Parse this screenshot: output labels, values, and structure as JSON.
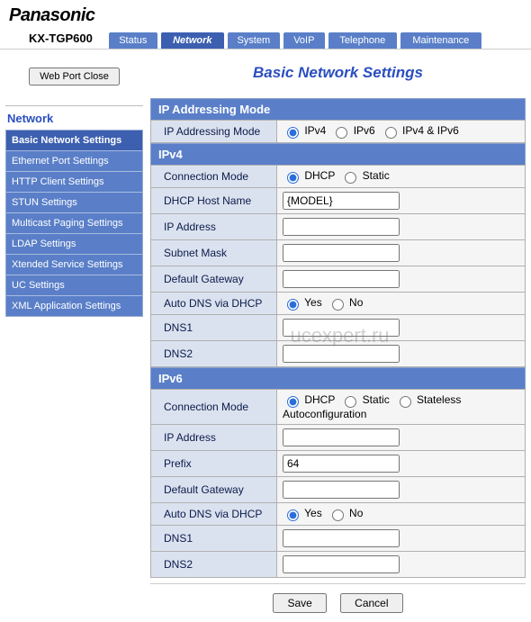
{
  "brand": "Panasonic",
  "model": "KX-TGP600",
  "tabs": {
    "status": "Status",
    "network": "Network",
    "system": "System",
    "voip": "VoIP",
    "telephone": "Telephone",
    "maintenance": "Maintenance"
  },
  "activeTab": "network",
  "sidebar": {
    "webport_btn": "Web Port Close",
    "title": "Network",
    "items": [
      "Basic Network Settings",
      "Ethernet Port Settings",
      "HTTP Client Settings",
      "STUN Settings",
      "Multicast Paging Settings",
      "LDAP Settings",
      "Xtended Service Settings",
      "UC Settings",
      "XML Application Settings"
    ],
    "activeIndex": 0
  },
  "page": {
    "title": "Basic Network Settings",
    "sections": {
      "ipmode": {
        "header": "IP Addressing Mode",
        "label": "IP Addressing Mode",
        "opts": [
          "IPv4",
          "IPv6",
          "IPv4 & IPv6"
        ],
        "selected": "IPv4"
      },
      "ipv4": {
        "header": "IPv4",
        "conn_label": "Connection Mode",
        "conn_opts": [
          "DHCP",
          "Static"
        ],
        "conn_selected": "DHCP",
        "dhcp_host_label": "DHCP Host Name",
        "dhcp_host_value": "{MODEL}",
        "ip_label": "IP Address",
        "ip_value": "",
        "mask_label": "Subnet Mask",
        "mask_value": "",
        "gw_label": "Default Gateway",
        "gw_value": "",
        "autodns_label": "Auto DNS via DHCP",
        "autodns_opts": [
          "Yes",
          "No"
        ],
        "autodns_selected": "Yes",
        "dns1_label": "DNS1",
        "dns1_value": "",
        "dns2_label": "DNS2",
        "dns2_value": ""
      },
      "ipv6": {
        "header": "IPv6",
        "conn_label": "Connection Mode",
        "conn_opts": [
          "DHCP",
          "Static",
          "Stateless Autoconfiguration"
        ],
        "conn_selected": "DHCP",
        "ip_label": "IP Address",
        "ip_value": "",
        "prefix_label": "Prefix",
        "prefix_value": "64",
        "gw_label": "Default Gateway",
        "gw_value": "",
        "autodns_label": "Auto DNS via DHCP",
        "autodns_opts": [
          "Yes",
          "No"
        ],
        "autodns_selected": "Yes",
        "dns1_label": "DNS1",
        "dns1_value": "",
        "dns2_label": "DNS2",
        "dns2_value": ""
      }
    },
    "save_btn": "Save",
    "cancel_btn": "Cancel"
  },
  "watermark": "ucexpert.ru"
}
